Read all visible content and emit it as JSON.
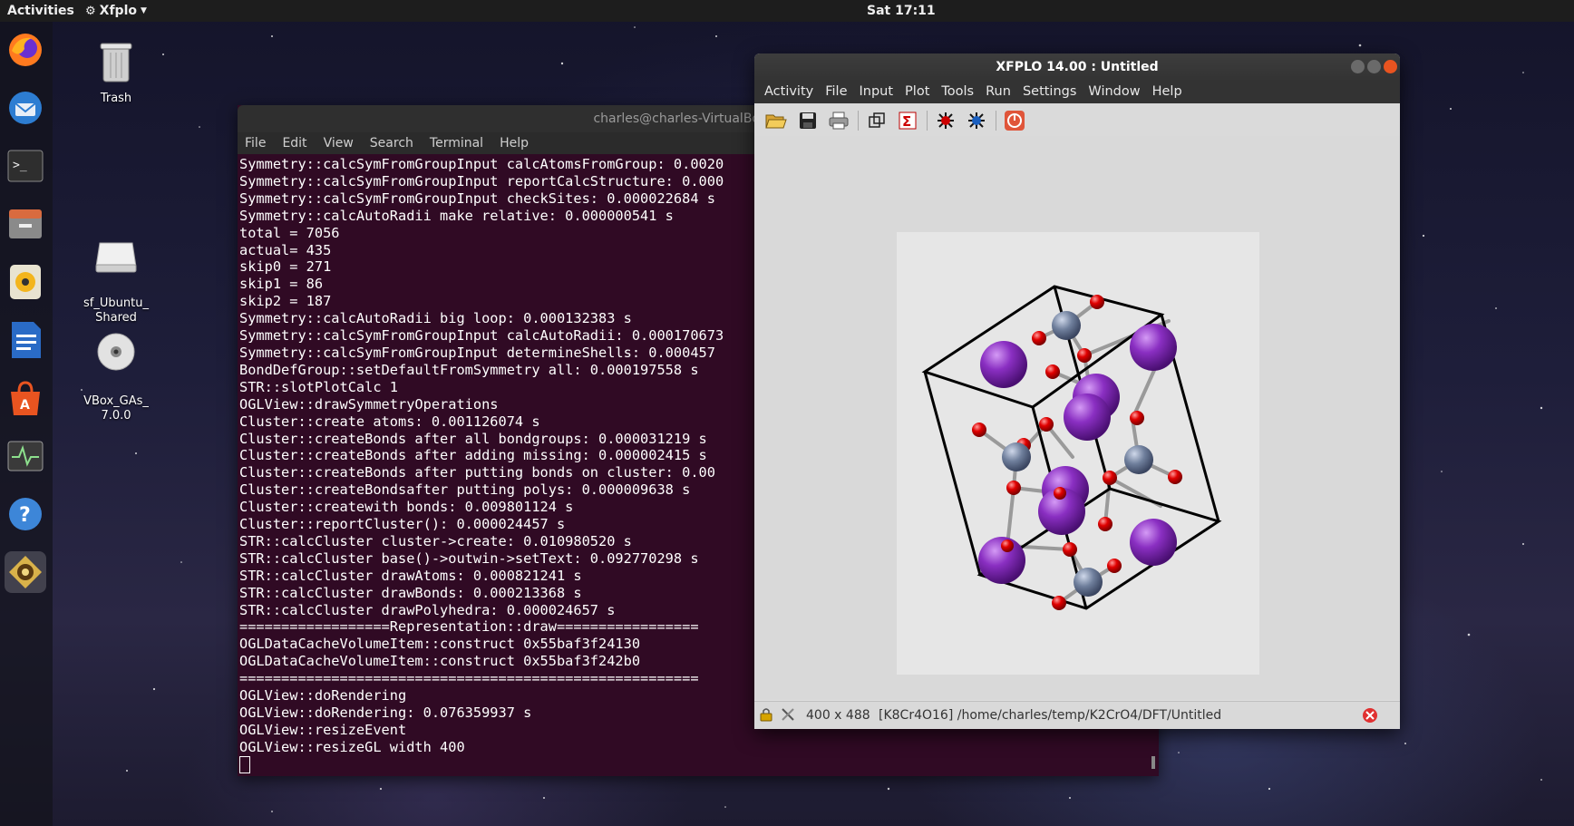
{
  "topbar": {
    "activities": "Activities",
    "app_menu": "Xfplo",
    "clock": "Sat 17:11"
  },
  "dock": {
    "items": [
      "firefox-icon",
      "thunderbird-icon",
      "terminal-icon",
      "files-icon",
      "rhythmbox-icon",
      "writer-icon",
      "software-icon",
      "monitor-icon",
      "help-icon",
      "xfplo-icon"
    ]
  },
  "desktop": {
    "icons": [
      {
        "label": "Trash"
      },
      {
        "label": "sf_Ubuntu_\nShared"
      },
      {
        "label": "VBox_GAs_\n7.0.0"
      }
    ]
  },
  "terminal": {
    "title": "charles@charles-VirtualBox: ~/te",
    "menu": [
      "File",
      "Edit",
      "View",
      "Search",
      "Terminal",
      "Help"
    ],
    "lines": [
      "Symmetry::calcSymFromGroupInput calcAtomsFromGroup: 0.0020",
      "Symmetry::calcSymFromGroupInput reportCalcStructure: 0.000",
      "Symmetry::calcSymFromGroupInput checkSites: 0.000022684 s",
      "Symmetry::calcAutoRadii make relative: 0.000000541 s",
      "total = 7056",
      "actual= 435",
      "skip0 = 271",
      "skip1 = 86",
      "skip2 = 187",
      "Symmetry::calcAutoRadii big loop: 0.000132383 s",
      "Symmetry::calcSymFromGroupInput calcAutoRadii: 0.000170673",
      "Symmetry::calcSymFromGroupInput determineShells: 0.000457",
      "BondDefGroup::setDefaultFromSymmetry all: 0.000197558 s",
      "STR::slotPlotCalc 1",
      "OGLView::drawSymmetryOperations",
      "Cluster::create atoms: 0.001126074 s",
      "Cluster::createBonds after all bondgroups: 0.000031219 s",
      "Cluster::createBonds after adding missing: 0.000002415 s",
      "Cluster::createBonds after putting bonds on cluster: 0.00",
      "Cluster::createBondsafter putting polys: 0.000009638 s",
      "Cluster::createwith bonds: 0.009801124 s",
      "Cluster::reportCluster(): 0.000024457 s",
      "STR::calcCluster cluster->create: 0.010980520 s",
      "STR::calcCluster base()->outwin->setText: 0.092770298 s",
      "STR::calcCluster drawAtoms: 0.000821241 s",
      "STR::calcCluster drawBonds: 0.000213368 s",
      "STR::calcCluster drawPolyhedra: 0.000024657 s",
      "==================Representation::draw=================",
      "OGLDataCacheVolumeItem::construct 0x55baf3f24130",
      "OGLDataCacheVolumeItem::construct 0x55baf3f242b0",
      "=======================================================",
      "OGLView::doRendering",
      "OGLView::doRendering: 0.076359937 s",
      "OGLView::resizeEvent",
      "OGLView::resizeGL width 400"
    ]
  },
  "xfplo": {
    "title": "XFPLO 14.00 : Untitled",
    "menu": [
      "Activity",
      "File",
      "Input",
      "Plot",
      "Tools",
      "Run",
      "Settings",
      "Window",
      "Help"
    ],
    "toolbar": [
      "open-icon",
      "save-icon",
      "print-icon",
      "copy-view-icon",
      "sigma-icon",
      "atom-red-icon",
      "atom-blue-icon",
      "power-icon"
    ],
    "status": {
      "size": "400 x 488",
      "path": "[K8Cr4O16] /home/charles/temp/K2CrO4/DFT/Untitled"
    }
  },
  "colors": {
    "terminal_bg": "#300a24",
    "k_atom": "#8a2fc2",
    "cr_atom": "#6f7f9c",
    "o_atom": "#e00000"
  }
}
